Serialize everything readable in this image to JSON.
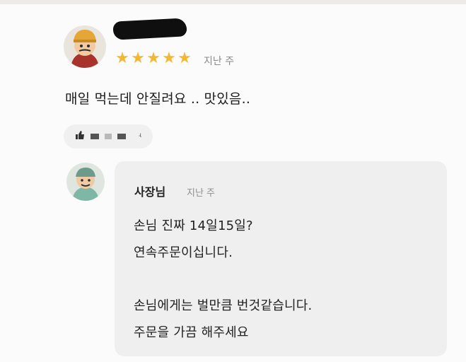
{
  "review": {
    "rating_stars": [
      "★",
      "★",
      "★",
      "★",
      "★"
    ],
    "rating": 5,
    "date": "지난 주",
    "text": "매일 먹는데 안질려요 .. 맛있음..",
    "menu_chip_icon": "thumbs-up-icon",
    "menu_chip_trailing": "ʵ"
  },
  "reply": {
    "author": "사장님",
    "date": "지난 주",
    "lines": [
      "손님 진짜 14일15일?",
      "연속주문이십니다.",
      "",
      "손님에게는 벌만큼 번것같습니다.",
      "주문을 가끔 해주세요"
    ]
  },
  "colors": {
    "star": "#f4b731",
    "bubble": "#efefef",
    "redaction": "#0f0f0f"
  }
}
